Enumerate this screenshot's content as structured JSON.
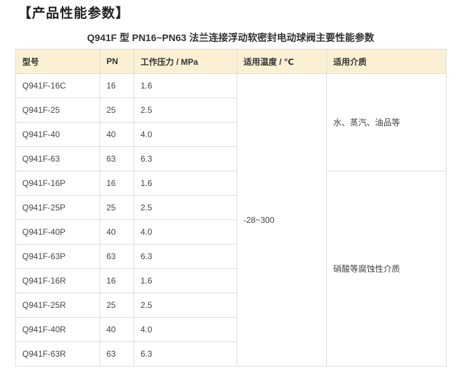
{
  "section_title": "【产品性能参数】",
  "table_caption": "Q941F 型 PN16~PN63 法兰连接浮动软密封电动球阀主要性能参数",
  "headers": [
    "型号",
    "PN",
    "工作压力 / MPa",
    "适用温度 / ℃",
    "适用介质"
  ],
  "rows": [
    {
      "model": "Q941F-16C",
      "pn": "16",
      "pressure": "1.6"
    },
    {
      "model": "Q941F-25",
      "pn": "25",
      "pressure": "2.5"
    },
    {
      "model": "Q941F-40",
      "pn": "40",
      "pressure": "4.0"
    },
    {
      "model": "Q941F-63",
      "pn": "63",
      "pressure": "6.3"
    },
    {
      "model": "Q941F-16P",
      "pn": "16",
      "pressure": "1.6"
    },
    {
      "model": "Q941F-25P",
      "pn": "25",
      "pressure": "2.5"
    },
    {
      "model": "Q941F-40P",
      "pn": "40",
      "pressure": "4.0"
    },
    {
      "model": "Q941F-63P",
      "pn": "63",
      "pressure": "6.3"
    },
    {
      "model": "Q941F-16R",
      "pn": "16",
      "pressure": "1.6"
    },
    {
      "model": "Q941F-25R",
      "pn": "25",
      "pressure": "2.5"
    },
    {
      "model": "Q941F-40R",
      "pn": "40",
      "pressure": "4.0"
    },
    {
      "model": "Q941F-63R",
      "pn": "63",
      "pressure": "6.3"
    }
  ],
  "temperature": "-28~300",
  "media": [
    "水、蒸汽、油品等",
    "硝酸等腐蚀性介质"
  ]
}
